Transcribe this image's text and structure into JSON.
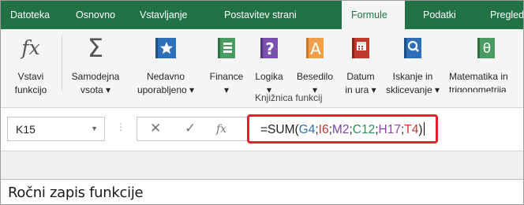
{
  "tabs": [
    {
      "label": "Datoteka",
      "active": false
    },
    {
      "label": "Osnovno",
      "active": false
    },
    {
      "label": "Vstavljanje",
      "active": false
    },
    {
      "label": "Postavitev strani",
      "active": false
    },
    {
      "label": "Formule",
      "active": true
    },
    {
      "label": "Podatki",
      "active": false
    },
    {
      "label": "Pregled",
      "active": false
    }
  ],
  "ribbon": {
    "group_label": "Knjižnica funkcij",
    "buttons": [
      {
        "line1": "Vstavi",
        "line2": "funkcijo",
        "icon": "fx-icon"
      },
      {
        "line1": "Samodejna",
        "line2": "vsota ▾",
        "icon": "sigma-icon"
      },
      {
        "line1": "Nedavno",
        "line2": "uporabljeno ▾",
        "icon": "star-icon"
      },
      {
        "line1": "Finance",
        "line2": "▾",
        "icon": "finance-book-icon"
      },
      {
        "line1": "Logika",
        "line2": "▾",
        "icon": "logic-book-icon"
      },
      {
        "line1": "Besedilo",
        "line2": "▾",
        "icon": "text-book-icon"
      },
      {
        "line1": "Datum",
        "line2": "in ura ▾",
        "icon": "calendar-book-icon"
      },
      {
        "line1": "Iskanje in",
        "line2": "sklicevanje ▾",
        "icon": "lookup-book-icon"
      },
      {
        "line1": "Matematika in",
        "line2": "trigonometrija",
        "icon": "math-book-icon"
      }
    ]
  },
  "formula_bar": {
    "name_box": "K15",
    "cancel_symbol": "✕",
    "enter_symbol": "✓",
    "fx_symbol": "fx",
    "formula_parts": [
      {
        "text": "=SUM(",
        "color": "#222222"
      },
      {
        "text": "G4",
        "color": "#2f6eb5"
      },
      {
        "text": ";",
        "color": "#222222"
      },
      {
        "text": "I6",
        "color": "#c0392b"
      },
      {
        "text": ";",
        "color": "#222222"
      },
      {
        "text": "M2",
        "color": "#7b3fa0"
      },
      {
        "text": ";",
        "color": "#222222"
      },
      {
        "text": "C12",
        "color": "#2e8b57"
      },
      {
        "text": ";",
        "color": "#222222"
      },
      {
        "text": "H17",
        "color": "#8e44ad"
      },
      {
        "text": ";",
        "color": "#222222"
      },
      {
        "text": "T4",
        "color": "#c0392b"
      },
      {
        "text": ")",
        "color": "#222222"
      }
    ]
  },
  "caption": "Ročni zapis funkcije",
  "colors": {
    "ribbon_green": "#217346",
    "highlight_red": "#e2222b",
    "icon_blue": "#2e6fb7",
    "icon_green": "#4a9c62",
    "icon_purple": "#7b4fae",
    "icon_orange": "#e6913a"
  }
}
